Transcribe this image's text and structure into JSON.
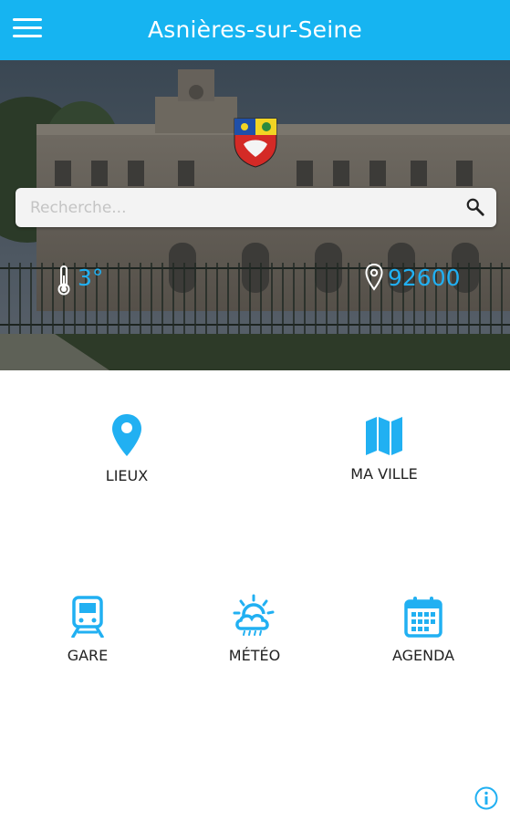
{
  "header": {
    "title": "Asnières-sur-Seine",
    "menu_icon": "hamburger-menu-icon"
  },
  "hero": {
    "search_placeholder": "Recherche...",
    "temperature": "3°",
    "postal_code": "92600"
  },
  "tiles": [
    {
      "label": "LIEUX",
      "icon": "map-pin-icon"
    },
    {
      "label": "MA VILLE",
      "icon": "folded-map-icon"
    },
    {
      "label": "GARE",
      "icon": "train-icon"
    },
    {
      "label": "MÉTÉO",
      "icon": "weather-icon"
    },
    {
      "label": "AGENDA",
      "icon": "calendar-icon"
    }
  ],
  "colors": {
    "accent": "#16b4f1",
    "icon_blue": "#21b0f2"
  }
}
